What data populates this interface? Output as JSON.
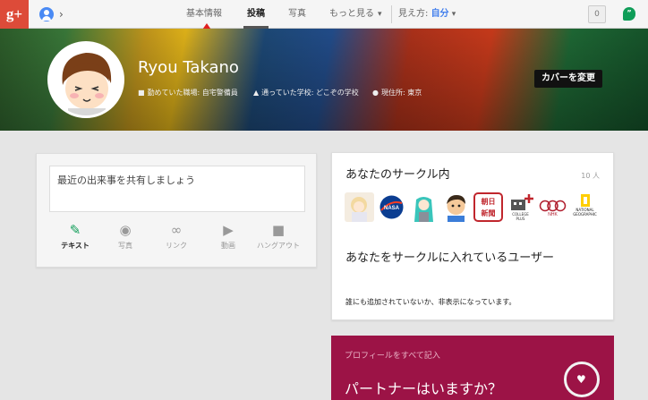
{
  "app": {
    "logo_text": "g+"
  },
  "topbar": {
    "nav": [
      {
        "label": "基本情報"
      },
      {
        "label": "投稿"
      },
      {
        "label": "写真"
      },
      {
        "label": "もっと見る"
      }
    ],
    "view_as_label": "見え方:",
    "view_as_value": "自分",
    "notification_count": "0"
  },
  "profile": {
    "name": "Ryou Takano",
    "work": "勤めていた職場: 自宅警備員",
    "school": "通っていた学校: どこぞの学校",
    "location": "現住所: 東京",
    "change_cover_label": "カバーを変更"
  },
  "share": {
    "placeholder": "最近の出来事を共有しましょう",
    "options": [
      {
        "label": "テキスト",
        "icon": "pencil-icon"
      },
      {
        "label": "写真",
        "icon": "camera-icon"
      },
      {
        "label": "リンク",
        "icon": "link-icon"
      },
      {
        "label": "動画",
        "icon": "video-play-icon"
      },
      {
        "label": "ハングアウト",
        "icon": "video-camera-icon"
      }
    ]
  },
  "circles": {
    "title": "あなたのサークル内",
    "count": "10 人",
    "members": [
      {
        "icon": "anime-girl-avatar"
      },
      {
        "icon": "nasa-logo",
        "text": "NASA"
      },
      {
        "icon": "miku-avatar"
      },
      {
        "icon": "cartoon-man-avatar"
      },
      {
        "icon": "asahi-shimbun-logo",
        "text": "朝日\n新聞"
      },
      {
        "icon": "college-plus-logo",
        "text": "COLLEGE\nPLUS"
      },
      {
        "icon": "nhk-logo",
        "text": "NHK"
      },
      {
        "icon": "national-geographic-logo",
        "text": "NATIONAL\nGEOGRAPHIC"
      }
    ],
    "added_title": "あなたをサークルに入れているユーザー",
    "added_desc": "誰にも追加されていないか、非表示になっています。"
  },
  "partner": {
    "header": "プロフィールをすべて記入",
    "question": "パートナーはいますか？"
  },
  "colors": {
    "accent": "#dd4b39",
    "link": "#427fed",
    "partner_bg": "#9c1346",
    "hangout_green": "#0f9d58"
  }
}
